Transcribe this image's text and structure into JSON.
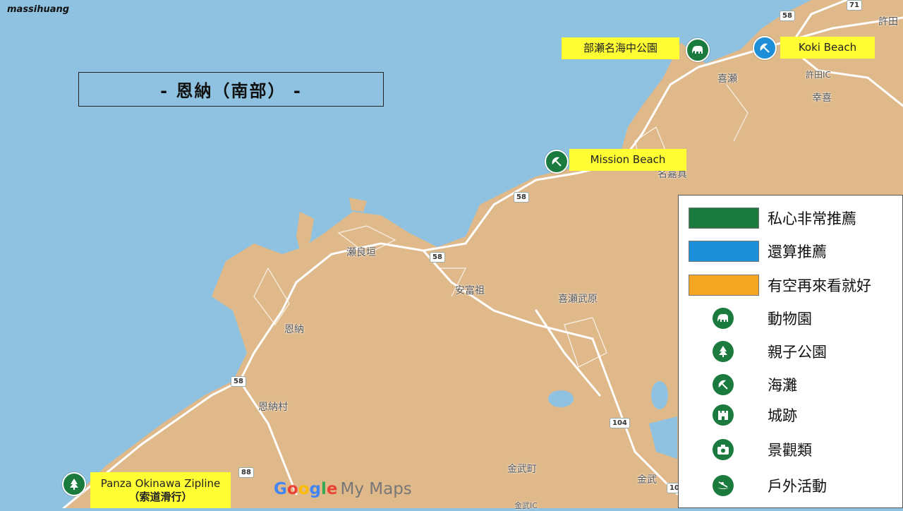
{
  "watermark": "massihuang",
  "title": "- 恩納（南部） -",
  "places": {
    "bise_park": "部瀬名海中公園",
    "koki_beach": "Koki Beach",
    "mission_beach": "Mission Beach",
    "panza_line1": "Panza Okinawa Zipline",
    "panza_line2": "（索道滑行）"
  },
  "towns": {
    "kise": "喜瀬",
    "kyodaic": "許田IC",
    "kyoda": "許田",
    "koki": "幸喜",
    "nakama": "名嘉真",
    "serakaki": "瀬良垣",
    "afuso": "安富祖",
    "kisebu": "喜瀬武原",
    "onna": "恩納",
    "onnason": "恩納村",
    "kin": "金武町",
    "kin2": "金武",
    "kinic": "金武IC"
  },
  "routes": {
    "r58a": "58",
    "r71": "71",
    "r58b": "58",
    "r58c": "58",
    "r58d": "58",
    "r104": "104",
    "r88": "88",
    "r10": "10"
  },
  "legend": {
    "color_items": [
      {
        "label": "私心非常推薦",
        "color": "#1b7a3e"
      },
      {
        "label": "還算推薦",
        "color": "#1d8fd8"
      },
      {
        "label": "有空再來看就好",
        "color": "#f5a623"
      }
    ],
    "icon_items": [
      {
        "label": "動物園",
        "icon": "elephant-icon"
      },
      {
        "label": "親子公園",
        "icon": "tree-icon"
      },
      {
        "label": "海灘",
        "icon": "beach-umbrella-icon"
      },
      {
        "label": "城跡",
        "icon": "castle-icon"
      },
      {
        "label": "景觀類",
        "icon": "camera-icon"
      },
      {
        "label": "戶外活動",
        "icon": "kayak-icon"
      }
    ]
  },
  "google": {
    "g": "Google",
    "mymaps": "My Maps"
  },
  "colors": {
    "sea": "#8ec2e0",
    "land": "#e0b98a",
    "road": "#ffffff",
    "highlight": "#ffff33",
    "pin_green": "#1b7a3e",
    "pin_blue": "#1d8fd8"
  }
}
